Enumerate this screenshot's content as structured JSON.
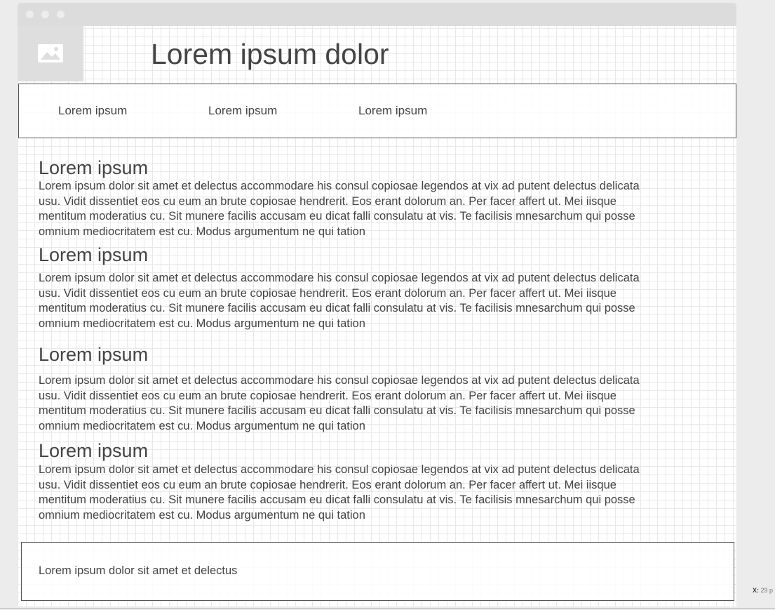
{
  "header": {
    "title": "Lorem ipsum dolor",
    "logo_icon": "image-placeholder-icon"
  },
  "nav": {
    "items": [
      {
        "label": "Lorem ipsum"
      },
      {
        "label": "Lorem ipsum"
      },
      {
        "label": "Lorem ipsum"
      }
    ]
  },
  "sections": [
    {
      "title": "Lorem ipsum",
      "body": "Lorem ipsum dolor sit amet et delectus accommodare his consul copiosae legendos at vix ad putent delectus delicata usu. Vidit dissentiet eos cu eum an brute copiosae hendrerit. Eos erant dolorum an. Per facer affert ut. Mei iisque mentitum moderatius cu. Sit munere facilis accusam eu dicat falli consulatu at vis. Te facilisis mnesarchum qui posse omnium mediocritatem est cu. Modus argumentum ne qui tation"
    },
    {
      "title": "Lorem ipsum",
      "body": "Lorem ipsum dolor sit amet et delectus accommodare his consul copiosae legendos at vix ad putent delectus delicata usu. Vidit dissentiet eos cu eum an brute copiosae hendrerit. Eos erant dolorum an. Per facer affert ut. Mei iisque mentitum moderatius cu. Sit munere facilis accusam eu dicat falli consulatu at vis. Te facilisis mnesarchum qui posse omnium mediocritatem est cu. Modus argumentum ne qui tation"
    },
    {
      "title": "Lorem ipsum",
      "body": "Lorem ipsum dolor sit amet et delectus accommodare his consul copiosae legendos at vix ad putent delectus delicata usu. Vidit dissentiet eos cu eum an brute copiosae hendrerit. Eos erant dolorum an. Per facer affert ut. Mei iisque mentitum moderatius cu. Sit munere facilis accusam eu dicat falli consulatu at vis. Te facilisis mnesarchum qui posse omnium mediocritatem est cu. Modus argumentum ne qui tation"
    },
    {
      "title": "Lorem ipsum",
      "body": "Lorem ipsum dolor sit amet et delectus accommodare his consul copiosae legendos at vix ad putent delectus delicata usu. Vidit dissentiet eos cu eum an brute copiosae hendrerit. Eos erant dolorum an. Per facer affert ut. Mei iisque mentitum moderatius cu. Sit munere facilis accusam eu dicat falli consulatu at vis. Te facilisis mnesarchum qui posse omnium mediocritatem est cu. Modus argumentum ne qui tation"
    }
  ],
  "footer": {
    "text": "Lorem ipsum dolor sit amet et delectus"
  },
  "status": {
    "coord_label": "X:",
    "coord_value": "29 p"
  },
  "colors": {
    "grid_line": "#e9e9e9",
    "titlebar": "#dcdcdc",
    "border": "#555555",
    "text": "#444444"
  }
}
